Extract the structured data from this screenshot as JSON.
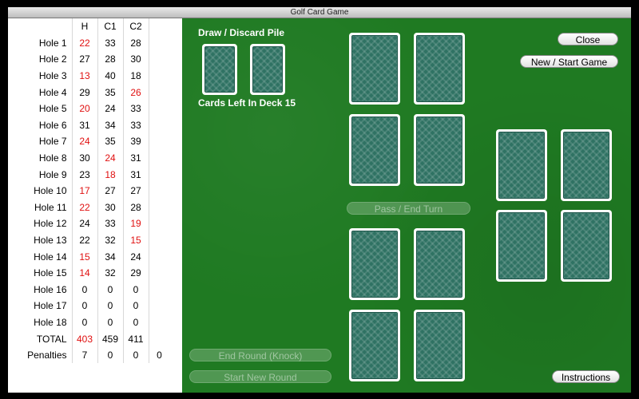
{
  "window": {
    "title": "Golf Card Game"
  },
  "scorecard": {
    "headers": [
      "",
      "H",
      "C1",
      "C2",
      ""
    ],
    "rows": [
      {
        "label": "Hole 1",
        "h": "22",
        "c1": "33",
        "c2": "28",
        "red": "h"
      },
      {
        "label": "Hole 2",
        "h": "27",
        "c1": "28",
        "c2": "30",
        "red": ""
      },
      {
        "label": "Hole 3",
        "h": "13",
        "c1": "40",
        "c2": "18",
        "red": "h"
      },
      {
        "label": "Hole 4",
        "h": "29",
        "c1": "35",
        "c2": "26",
        "red": "c2"
      },
      {
        "label": "Hole 5",
        "h": "20",
        "c1": "24",
        "c2": "33",
        "red": "h"
      },
      {
        "label": "Hole 6",
        "h": "31",
        "c1": "34",
        "c2": "33",
        "red": ""
      },
      {
        "label": "Hole 7",
        "h": "24",
        "c1": "35",
        "c2": "39",
        "red": "h"
      },
      {
        "label": "Hole 8",
        "h": "30",
        "c1": "24",
        "c2": "31",
        "red": "c1"
      },
      {
        "label": "Hole 9",
        "h": "23",
        "c1": "18",
        "c2": "31",
        "red": "c1"
      },
      {
        "label": "Hole 10",
        "h": "17",
        "c1": "27",
        "c2": "27",
        "red": "h"
      },
      {
        "label": "Hole 11",
        "h": "22",
        "c1": "30",
        "c2": "28",
        "red": "h"
      },
      {
        "label": "Hole 12",
        "h": "24",
        "c1": "33",
        "c2": "19",
        "red": "c2"
      },
      {
        "label": "Hole 13",
        "h": "22",
        "c1": "32",
        "c2": "15",
        "red": "c2"
      },
      {
        "label": "Hole 14",
        "h": "15",
        "c1": "34",
        "c2": "24",
        "red": "h"
      },
      {
        "label": "Hole 15",
        "h": "14",
        "c1": "32",
        "c2": "29",
        "red": "h"
      },
      {
        "label": "Hole 16",
        "h": "0",
        "c1": "0",
        "c2": "0",
        "red": ""
      },
      {
        "label": "Hole 17",
        "h": "0",
        "c1": "0",
        "c2": "0",
        "red": ""
      },
      {
        "label": "Hole 18",
        "h": "0",
        "c1": "0",
        "c2": "0",
        "red": ""
      },
      {
        "label": "TOTAL",
        "h": "403",
        "c1": "459",
        "c2": "411",
        "red": "h"
      },
      {
        "label": "Penalties",
        "h": "7",
        "c1": "0",
        "c2": "0",
        "extra": "0",
        "red": ""
      }
    ]
  },
  "table": {
    "draw_discard_label": "Draw / Discard Pile",
    "cards_left_label": "Cards Left In Deck 15",
    "buttons": {
      "close": "Close",
      "new_game": "New / Start Game",
      "pass_end_turn": "Pass / End Turn",
      "end_round": "End Round (Knock)",
      "start_new_round": "Start New Round",
      "instructions": "Instructions"
    }
  },
  "colors": {
    "felt": "#1f7a22",
    "card_back": "#2f7263",
    "low_score": "#e01010"
  }
}
